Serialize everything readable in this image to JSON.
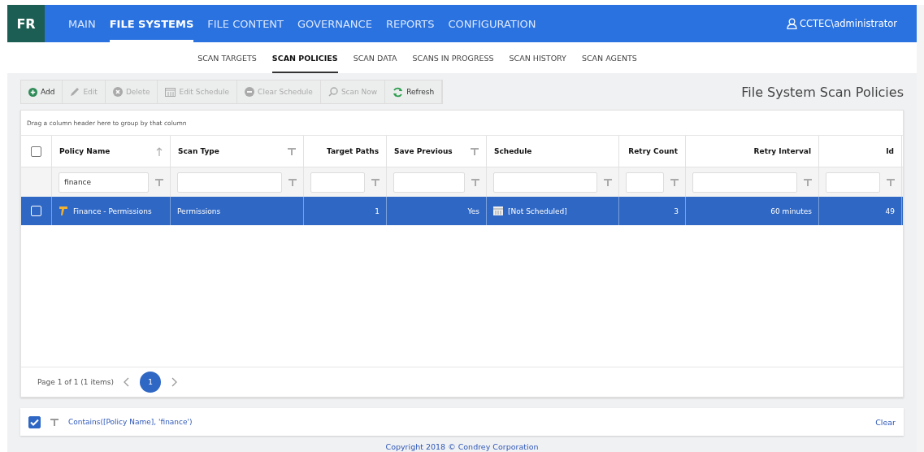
{
  "app_logo": "FR",
  "main_nav": [
    {
      "label": "MAIN",
      "selected": false
    },
    {
      "label": "FILE SYSTEMS",
      "selected": true
    },
    {
      "label": "FILE CONTENT",
      "selected": false
    },
    {
      "label": "GOVERNANCE",
      "selected": false
    },
    {
      "label": "REPORTS",
      "selected": false
    },
    {
      "label": "CONFIGURATION",
      "selected": false
    }
  ],
  "user": "CCTEC\\administrator",
  "sub_nav": [
    {
      "label": "SCAN TARGETS",
      "selected": false
    },
    {
      "label": "SCAN POLICIES",
      "selected": true
    },
    {
      "label": "SCAN DATA",
      "selected": false
    },
    {
      "label": "SCANS IN PROGRESS",
      "selected": false
    },
    {
      "label": "SCAN HISTORY",
      "selected": false
    },
    {
      "label": "SCAN AGENTS",
      "selected": false
    }
  ],
  "toolbar": [
    {
      "kind": "add",
      "label": "Add",
      "disabled": false
    },
    {
      "kind": "edit",
      "label": "Edit",
      "disabled": true
    },
    {
      "kind": "delete",
      "label": "Delete",
      "disabled": true
    },
    {
      "kind": "schedule",
      "label": "Edit Schedule",
      "disabled": true
    },
    {
      "kind": "clear",
      "label": "Clear Schedule",
      "disabled": true
    },
    {
      "kind": "scan",
      "label": "Scan Now",
      "disabled": true
    },
    {
      "kind": "refresh",
      "label": "Refresh",
      "disabled": false
    }
  ],
  "page_title": "File System Scan Policies",
  "group_panel_hint": "Drag a column header here to group by that column",
  "table": {
    "header_checked": false,
    "columns": [
      {
        "label": "Policy Name",
        "filter_value": "finance"
      },
      {
        "label": "Scan Type"
      },
      {
        "label": "Target Paths"
      },
      {
        "label": "Save Previous"
      },
      {
        "label": "Schedule"
      },
      {
        "label": "Retry Count"
      },
      {
        "label": "Retry Interval"
      },
      {
        "label": "Id"
      }
    ],
    "rows": [
      {
        "selected": true,
        "checked": false,
        "cells": [
          "Finance - Permissions",
          "Permissions",
          "1",
          "Yes",
          "[Not Scheduled]",
          "3",
          "60 minutes",
          "49"
        ]
      }
    ]
  },
  "pager": {
    "summary": "Page 1 of 1 (1 items)",
    "pages": [
      {
        "label": "1",
        "selected": true
      }
    ]
  },
  "filter_bar": {
    "enabled": true,
    "expression": "Contains([Policy Name], 'finance')",
    "clear": "Clear"
  },
  "footer": "Copyright 2018 © Condrey Corporation"
}
